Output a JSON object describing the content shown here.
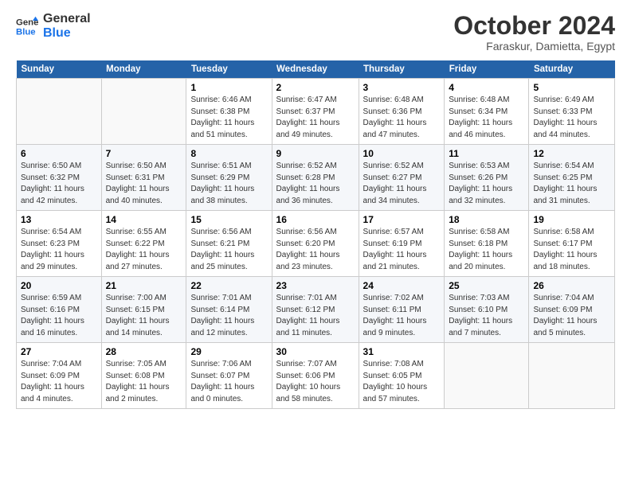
{
  "logo": {
    "line1": "General",
    "line2": "Blue"
  },
  "title": "October 2024",
  "location": "Faraskur, Damietta, Egypt",
  "weekdays": [
    "Sunday",
    "Monday",
    "Tuesday",
    "Wednesday",
    "Thursday",
    "Friday",
    "Saturday"
  ],
  "weeks": [
    [
      {
        "day": "",
        "sunrise": "",
        "sunset": "",
        "daylight": ""
      },
      {
        "day": "",
        "sunrise": "",
        "sunset": "",
        "daylight": ""
      },
      {
        "day": "1",
        "sunrise": "Sunrise: 6:46 AM",
        "sunset": "Sunset: 6:38 PM",
        "daylight": "Daylight: 11 hours and 51 minutes."
      },
      {
        "day": "2",
        "sunrise": "Sunrise: 6:47 AM",
        "sunset": "Sunset: 6:37 PM",
        "daylight": "Daylight: 11 hours and 49 minutes."
      },
      {
        "day": "3",
        "sunrise": "Sunrise: 6:48 AM",
        "sunset": "Sunset: 6:36 PM",
        "daylight": "Daylight: 11 hours and 47 minutes."
      },
      {
        "day": "4",
        "sunrise": "Sunrise: 6:48 AM",
        "sunset": "Sunset: 6:34 PM",
        "daylight": "Daylight: 11 hours and 46 minutes."
      },
      {
        "day": "5",
        "sunrise": "Sunrise: 6:49 AM",
        "sunset": "Sunset: 6:33 PM",
        "daylight": "Daylight: 11 hours and 44 minutes."
      }
    ],
    [
      {
        "day": "6",
        "sunrise": "Sunrise: 6:50 AM",
        "sunset": "Sunset: 6:32 PM",
        "daylight": "Daylight: 11 hours and 42 minutes."
      },
      {
        "day": "7",
        "sunrise": "Sunrise: 6:50 AM",
        "sunset": "Sunset: 6:31 PM",
        "daylight": "Daylight: 11 hours and 40 minutes."
      },
      {
        "day": "8",
        "sunrise": "Sunrise: 6:51 AM",
        "sunset": "Sunset: 6:29 PM",
        "daylight": "Daylight: 11 hours and 38 minutes."
      },
      {
        "day": "9",
        "sunrise": "Sunrise: 6:52 AM",
        "sunset": "Sunset: 6:28 PM",
        "daylight": "Daylight: 11 hours and 36 minutes."
      },
      {
        "day": "10",
        "sunrise": "Sunrise: 6:52 AM",
        "sunset": "Sunset: 6:27 PM",
        "daylight": "Daylight: 11 hours and 34 minutes."
      },
      {
        "day": "11",
        "sunrise": "Sunrise: 6:53 AM",
        "sunset": "Sunset: 6:26 PM",
        "daylight": "Daylight: 11 hours and 32 minutes."
      },
      {
        "day": "12",
        "sunrise": "Sunrise: 6:54 AM",
        "sunset": "Sunset: 6:25 PM",
        "daylight": "Daylight: 11 hours and 31 minutes."
      }
    ],
    [
      {
        "day": "13",
        "sunrise": "Sunrise: 6:54 AM",
        "sunset": "Sunset: 6:23 PM",
        "daylight": "Daylight: 11 hours and 29 minutes."
      },
      {
        "day": "14",
        "sunrise": "Sunrise: 6:55 AM",
        "sunset": "Sunset: 6:22 PM",
        "daylight": "Daylight: 11 hours and 27 minutes."
      },
      {
        "day": "15",
        "sunrise": "Sunrise: 6:56 AM",
        "sunset": "Sunset: 6:21 PM",
        "daylight": "Daylight: 11 hours and 25 minutes."
      },
      {
        "day": "16",
        "sunrise": "Sunrise: 6:56 AM",
        "sunset": "Sunset: 6:20 PM",
        "daylight": "Daylight: 11 hours and 23 minutes."
      },
      {
        "day": "17",
        "sunrise": "Sunrise: 6:57 AM",
        "sunset": "Sunset: 6:19 PM",
        "daylight": "Daylight: 11 hours and 21 minutes."
      },
      {
        "day": "18",
        "sunrise": "Sunrise: 6:58 AM",
        "sunset": "Sunset: 6:18 PM",
        "daylight": "Daylight: 11 hours and 20 minutes."
      },
      {
        "day": "19",
        "sunrise": "Sunrise: 6:58 AM",
        "sunset": "Sunset: 6:17 PM",
        "daylight": "Daylight: 11 hours and 18 minutes."
      }
    ],
    [
      {
        "day": "20",
        "sunrise": "Sunrise: 6:59 AM",
        "sunset": "Sunset: 6:16 PM",
        "daylight": "Daylight: 11 hours and 16 minutes."
      },
      {
        "day": "21",
        "sunrise": "Sunrise: 7:00 AM",
        "sunset": "Sunset: 6:15 PM",
        "daylight": "Daylight: 11 hours and 14 minutes."
      },
      {
        "day": "22",
        "sunrise": "Sunrise: 7:01 AM",
        "sunset": "Sunset: 6:14 PM",
        "daylight": "Daylight: 11 hours and 12 minutes."
      },
      {
        "day": "23",
        "sunrise": "Sunrise: 7:01 AM",
        "sunset": "Sunset: 6:12 PM",
        "daylight": "Daylight: 11 hours and 11 minutes."
      },
      {
        "day": "24",
        "sunrise": "Sunrise: 7:02 AM",
        "sunset": "Sunset: 6:11 PM",
        "daylight": "Daylight: 11 hours and 9 minutes."
      },
      {
        "day": "25",
        "sunrise": "Sunrise: 7:03 AM",
        "sunset": "Sunset: 6:10 PM",
        "daylight": "Daylight: 11 hours and 7 minutes."
      },
      {
        "day": "26",
        "sunrise": "Sunrise: 7:04 AM",
        "sunset": "Sunset: 6:09 PM",
        "daylight": "Daylight: 11 hours and 5 minutes."
      }
    ],
    [
      {
        "day": "27",
        "sunrise": "Sunrise: 7:04 AM",
        "sunset": "Sunset: 6:09 PM",
        "daylight": "Daylight: 11 hours and 4 minutes."
      },
      {
        "day": "28",
        "sunrise": "Sunrise: 7:05 AM",
        "sunset": "Sunset: 6:08 PM",
        "daylight": "Daylight: 11 hours and 2 minutes."
      },
      {
        "day": "29",
        "sunrise": "Sunrise: 7:06 AM",
        "sunset": "Sunset: 6:07 PM",
        "daylight": "Daylight: 11 hours and 0 minutes."
      },
      {
        "day": "30",
        "sunrise": "Sunrise: 7:07 AM",
        "sunset": "Sunset: 6:06 PM",
        "daylight": "Daylight: 10 hours and 58 minutes."
      },
      {
        "day": "31",
        "sunrise": "Sunrise: 7:08 AM",
        "sunset": "Sunset: 6:05 PM",
        "daylight": "Daylight: 10 hours and 57 minutes."
      },
      {
        "day": "",
        "sunrise": "",
        "sunset": "",
        "daylight": ""
      },
      {
        "day": "",
        "sunrise": "",
        "sunset": "",
        "daylight": ""
      }
    ]
  ]
}
